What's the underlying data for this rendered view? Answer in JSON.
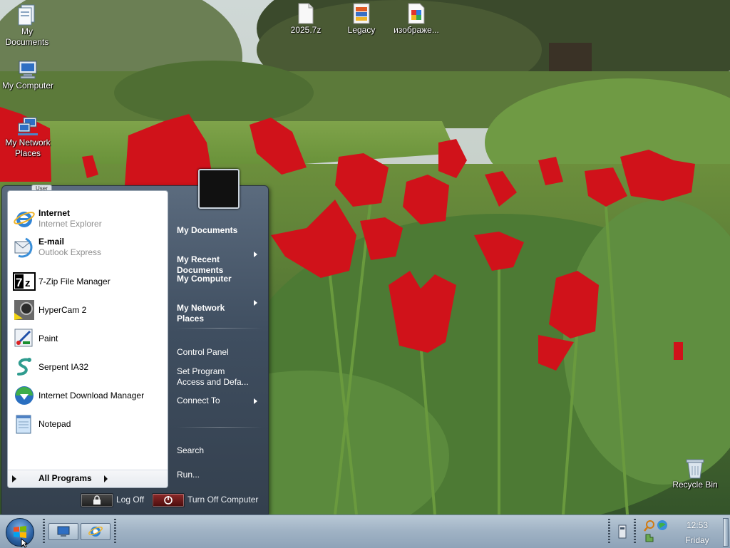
{
  "desktop": {
    "icons": [
      {
        "label": "My\nDocuments",
        "icon": "my-documents-icon"
      },
      {
        "label": "My Computer",
        "icon": "my-computer-icon"
      },
      {
        "label": "My Network\nPlaces",
        "icon": "network-icon"
      },
      {
        "label": "2025.7z",
        "icon": "file-icon"
      },
      {
        "label": "Legacy",
        "icon": "archive-icon"
      },
      {
        "label": "изображе...",
        "icon": "image-file-icon"
      },
      {
        "label": "Recycle Bin",
        "icon": "recycle-bin-icon"
      }
    ]
  },
  "start_menu": {
    "user_label": "User",
    "pinned": [
      {
        "title": "Internet",
        "subtitle": "Internet Explorer",
        "icon": "internet-explorer-icon"
      },
      {
        "title": "E-mail",
        "subtitle": "Outlook Express",
        "icon": "outlook-express-icon"
      }
    ],
    "programs": [
      {
        "label": "7-Zip File Manager",
        "icon": "7zip-icon"
      },
      {
        "label": "HyperCam 2",
        "icon": "hypercam-icon"
      },
      {
        "label": "Paint",
        "icon": "paint-icon"
      },
      {
        "label": "Serpent IA32",
        "icon": "serpent-icon"
      },
      {
        "label": "Internet Download Manager",
        "icon": "idm-icon"
      },
      {
        "label": "Notepad",
        "icon": "notepad-icon"
      }
    ],
    "all_programs": "All Programs",
    "right": {
      "my_documents": "My Documents",
      "my_recent_documents": "My Recent\nDocuments",
      "my_computer": "My Computer",
      "my_network_places": "My Network\nPlaces",
      "control_panel": "Control Panel",
      "set_program_access": "Set Program\nAccess and Defa...",
      "connect_to": "Connect To",
      "search": "Search",
      "run": "Run..."
    },
    "log_off": "Log Off",
    "turn_off": "Turn Off Computer"
  },
  "taskbar": {
    "clock_time": "12:53",
    "clock_day": "Friday"
  },
  "colors": {
    "menu_dark": "#34404e",
    "taskbar": "#9fb2c4",
    "log_off_button": "#2c2c2c",
    "turn_off_button": "#7a1a1a"
  }
}
